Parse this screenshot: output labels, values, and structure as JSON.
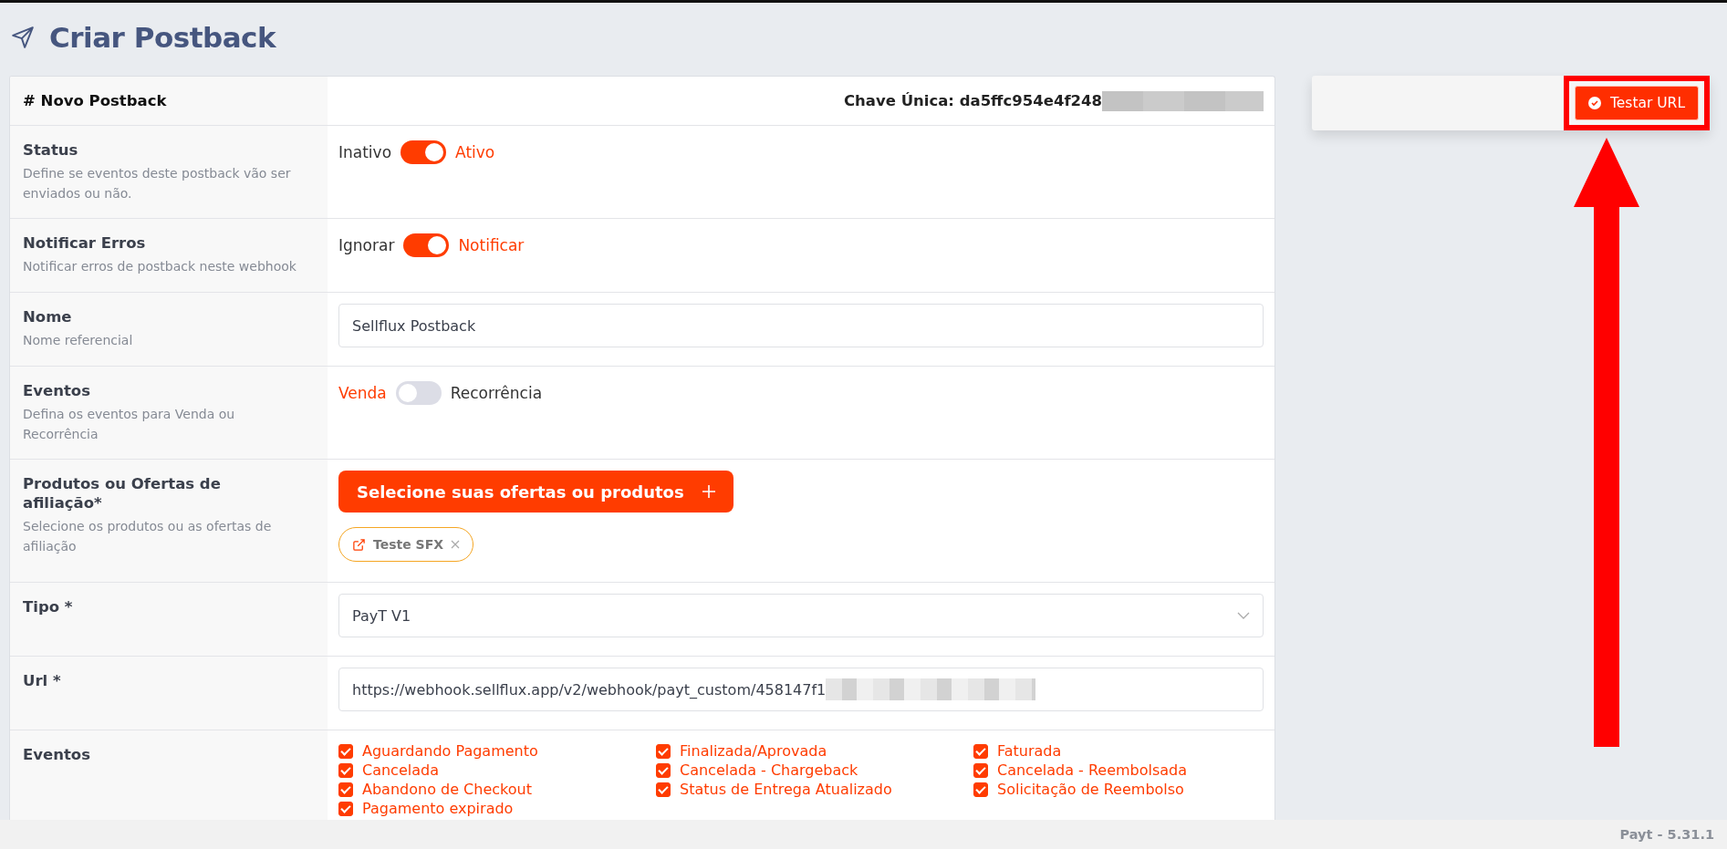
{
  "page": {
    "title": "Criar Postback"
  },
  "form": {
    "header": {
      "title": "# Novo Postback",
      "key_label": "Chave Única: da5ffc954e4f248",
      "redacted": true
    },
    "rows": [
      {
        "kind": "toggle",
        "label": "Status",
        "description": "Define se eventos deste postback vão ser enviados ou não.",
        "off_label": "Inativo",
        "on_label": "Ativo",
        "on": true
      },
      {
        "kind": "toggle",
        "label": "Notificar Erros",
        "description": "Notificar erros de postback neste webhook",
        "off_label": "Ignorar",
        "on_label": "Notificar",
        "on": true
      },
      {
        "kind": "text",
        "label": "Nome",
        "description": "Nome referencial",
        "value": "Sellflux Postback",
        "redacted": false
      },
      {
        "kind": "toggle",
        "label": "Eventos",
        "description": "Defina os eventos para Venda ou Recorrência",
        "off_label": "Venda",
        "on_label": "Recorrência",
        "on": false
      },
      {
        "kind": "picker",
        "label": "Produtos ou Ofertas de afiliação*",
        "description": "Selecione os produtos ou as ofertas de afiliação",
        "button": "Selecione suas ofertas ou produtos",
        "tags": [
          "Teste SFX"
        ]
      },
      {
        "kind": "select",
        "label": "Tipo *",
        "value": "PayT V1"
      },
      {
        "kind": "text",
        "label": "Url *",
        "value": "https://webhook.sellflux.app/v2/webhook/payt_custom/458147f1",
        "redacted": true
      },
      {
        "kind": "checks",
        "label": "Eventos",
        "options": [
          {
            "label": "Aguardando Pagamento",
            "checked": true
          },
          {
            "label": "Finalizada/Aprovada",
            "checked": true
          },
          {
            "label": "Faturada",
            "checked": true
          },
          {
            "label": "Cancelada",
            "checked": true
          },
          {
            "label": "Cancelada - Chargeback",
            "checked": true
          },
          {
            "label": "Cancelada - Reembolsada",
            "checked": true
          },
          {
            "label": "Abandono de Checkout",
            "checked": true
          },
          {
            "label": "Status de Entrega Atualizado",
            "checked": true
          },
          {
            "label": "Solicitação de Reembolso",
            "checked": true
          },
          {
            "label": "Pagamento expirado",
            "checked": true
          }
        ]
      }
    ]
  },
  "test_panel": {
    "button": "Testar URL"
  },
  "footer": {
    "version": "Payt - 5.31.1"
  }
}
